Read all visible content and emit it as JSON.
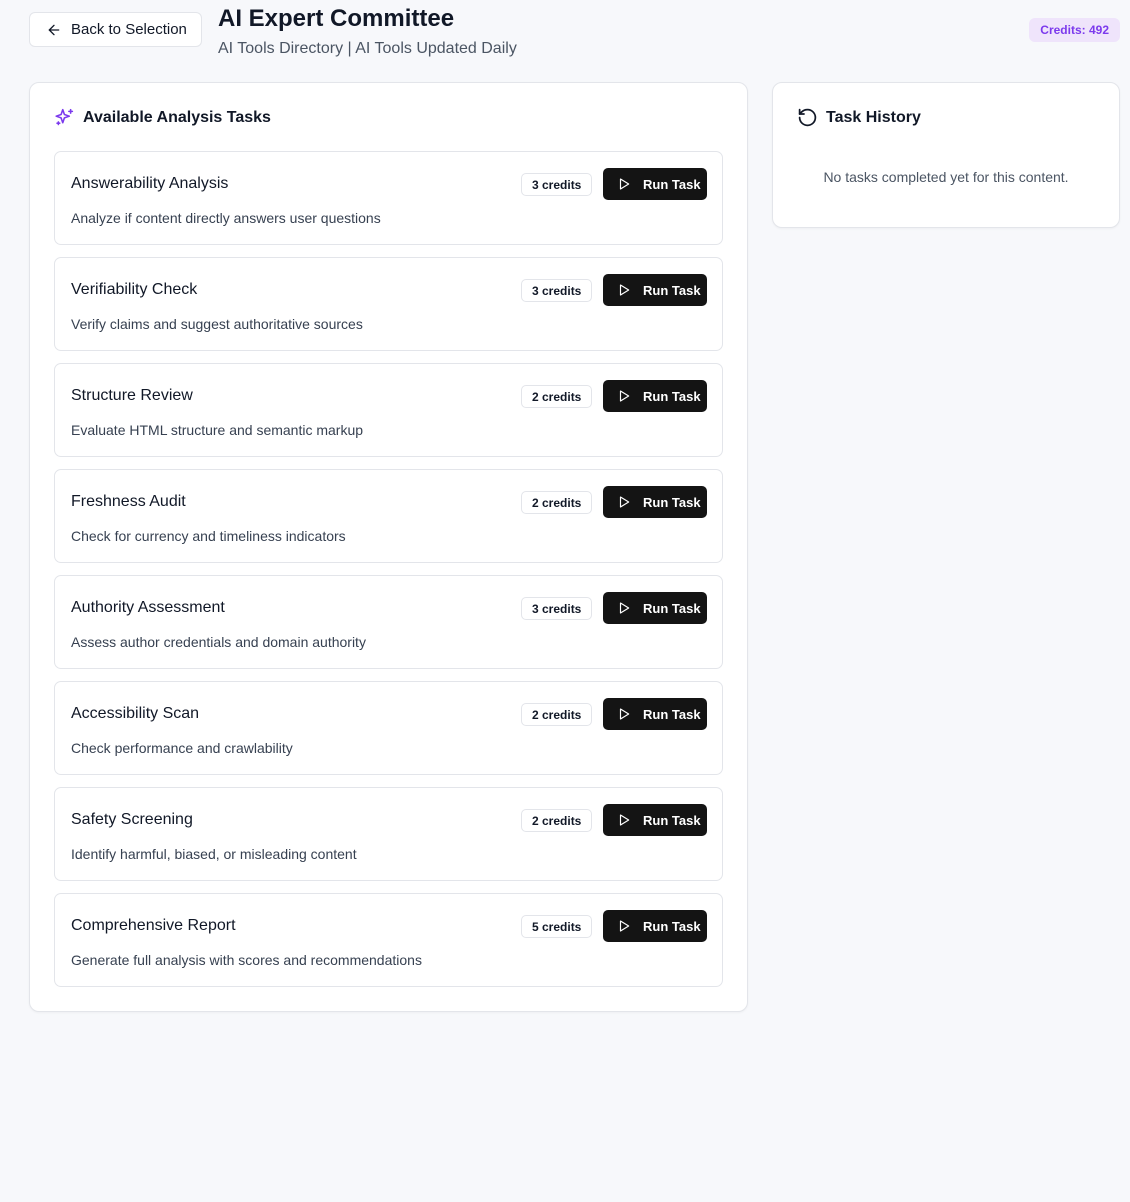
{
  "header": {
    "back_label": "Back to Selection",
    "title": "AI Expert Committee",
    "subtitle": "AI Tools Directory | AI Tools Updated Daily",
    "credits_label": "Credits: 492"
  },
  "tasks_panel": {
    "title": "Available Analysis Tasks",
    "run_label": "Run Task",
    "items": [
      {
        "title": "Answerability Analysis",
        "description": "Analyze if content directly answers user questions",
        "credits": "3 credits"
      },
      {
        "title": "Verifiability Check",
        "description": "Verify claims and suggest authoritative sources",
        "credits": "3 credits"
      },
      {
        "title": "Structure Review",
        "description": "Evaluate HTML structure and semantic markup",
        "credits": "2 credits"
      },
      {
        "title": "Freshness Audit",
        "description": "Check for currency and timeliness indicators",
        "credits": "2 credits"
      },
      {
        "title": "Authority Assessment",
        "description": "Assess author credentials and domain authority",
        "credits": "3 credits"
      },
      {
        "title": "Accessibility Scan",
        "description": "Check performance and crawlability",
        "credits": "2 credits"
      },
      {
        "title": "Safety Screening",
        "description": "Identify harmful, biased, or misleading content",
        "credits": "2 credits"
      },
      {
        "title": "Comprehensive Report",
        "description": "Generate full analysis with scores and recommendations",
        "credits": "5 credits"
      }
    ]
  },
  "history_panel": {
    "title": "Task History",
    "empty_text": "No tasks completed yet for this content."
  },
  "icons": {
    "back": "arrow-left-icon",
    "tasks": "sparkles-icon",
    "history": "rotate-ccw-icon",
    "run": "play-icon"
  },
  "colors": {
    "accent": "#7c3aed",
    "badge_bg": "#efe4fb",
    "run_button_bg": "#141414",
    "page_bg": "#f7f8fb"
  }
}
